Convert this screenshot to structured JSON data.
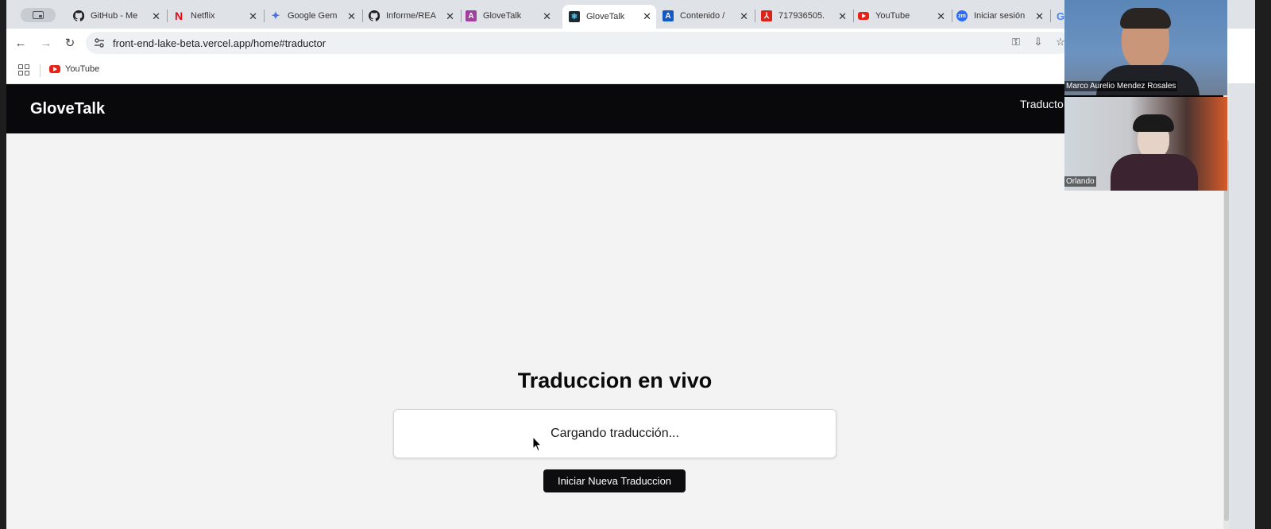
{
  "browser": {
    "tabs": [
      {
        "title": "GitHub - Me",
        "icon": "github-icon"
      },
      {
        "title": "Netflix",
        "icon": "netflix-icon"
      },
      {
        "title": "Google Gem",
        "icon": "gemini-icon"
      },
      {
        "title": "Informe/REA",
        "icon": "github-icon"
      },
      {
        "title": "GloveTalk",
        "icon": "angular-icon"
      },
      {
        "title": "GloveTalk",
        "icon": "react-icon",
        "active": true
      },
      {
        "title": "Contenido /",
        "icon": "app-icon"
      },
      {
        "title": "717936505.",
        "icon": "pdf-icon"
      },
      {
        "title": "YouTube",
        "icon": "youtube-icon"
      },
      {
        "title": "Iniciar sesión",
        "icon": "zoom-icon"
      }
    ],
    "url": "front-end-lake-beta.vercel.app/home#traductor",
    "bookmarks": [
      {
        "label": "YouTube",
        "icon": "youtube-icon"
      }
    ]
  },
  "app": {
    "brand": "GloveTalk",
    "nav_link": "Traducto",
    "heading": "Traduccion en vivo",
    "output_text": "Cargando traducción...",
    "button_label": "Iniciar Nueva Traduccion"
  },
  "call": {
    "participants": [
      {
        "name": "Marco Aurelio Mendez Rosales"
      },
      {
        "name": "Orlando"
      }
    ]
  },
  "colors": {
    "header_bg": "#09090b",
    "page_bg": "#f3f3f3",
    "button_bg": "#0d0d0f"
  }
}
